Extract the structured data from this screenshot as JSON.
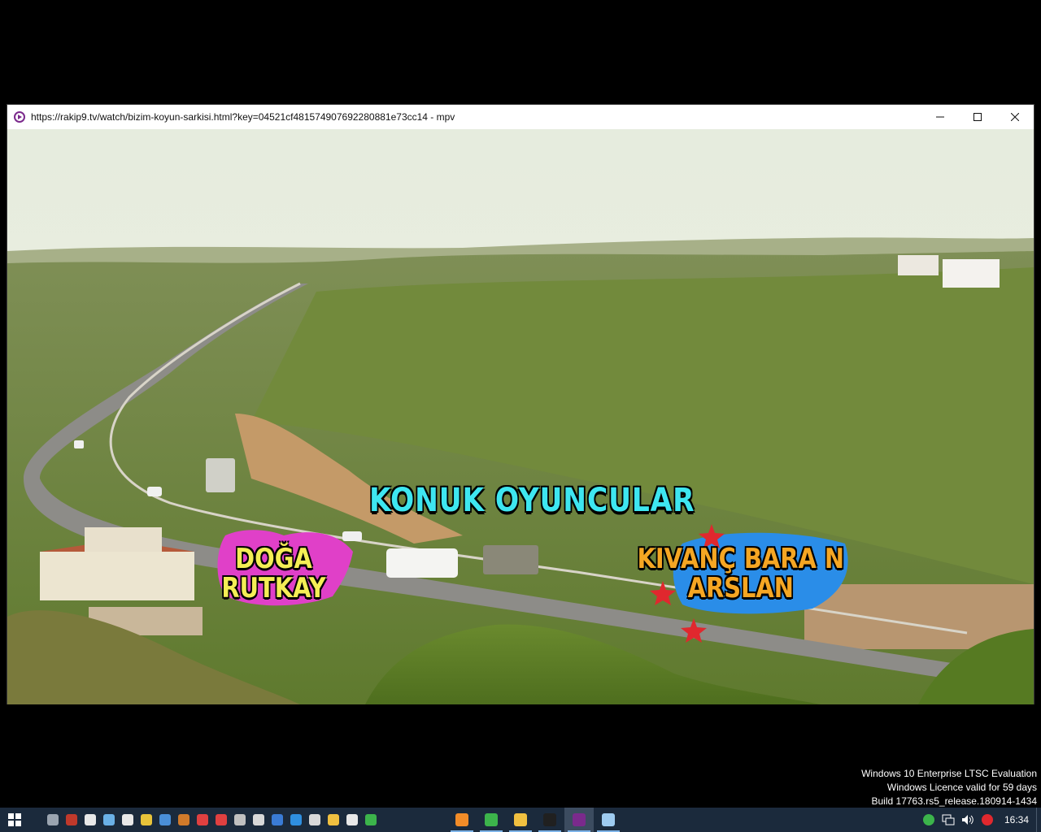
{
  "window": {
    "title": "https://rakip9.tv/watch/bizim-koyun-sarkisi.html?key=04521cf481574907692280881e73cc14 - mpv",
    "app": "mpv",
    "controls": {
      "minimize": "minimize-icon",
      "maximize": "maximize-icon",
      "close": "close-icon"
    }
  },
  "video": {
    "credits_heading": "KONUK OYUNCULAR",
    "credits": [
      {
        "line1": "DOĞA",
        "line2": "RUTKAY"
      },
      {
        "line1": "KIVANÇ BARA N",
        "line2": "ARSLAN"
      }
    ],
    "colors": {
      "heading": "#3ee6f0",
      "name1": "#f4ee55",
      "name2": "#f5a623",
      "splash1": "#e040c8",
      "splash2": "#2a8de8"
    }
  },
  "watermark": {
    "line1": "Windows 10 Enterprise LTSC Evaluation",
    "line2": "Windows Licence valid for 59 days",
    "line3": "Build 17763.rs5_release.180914-1434"
  },
  "taskbar": {
    "start_icon": "windows-icon",
    "quicklaunch": [
      {
        "name": "disk-icon",
        "color": "#9aa4b0"
      },
      {
        "name": "archive-icon",
        "color": "#c0392b"
      },
      {
        "name": "document-icon",
        "color": "#e8e8e8"
      },
      {
        "name": "recycle-icon",
        "color": "#6ab0e6"
      },
      {
        "name": "chess-icon",
        "color": "#e8e8e8"
      },
      {
        "name": "chrome-icon",
        "color": "#e8c33a"
      },
      {
        "name": "rocket-icon",
        "color": "#4a8fd8"
      },
      {
        "name": "gun-icon",
        "color": "#d07a2a"
      },
      {
        "name": "stop-icon",
        "color": "#e04040"
      },
      {
        "name": "compass-icon",
        "color": "#e04040"
      },
      {
        "name": "gear-icon",
        "color": "#c0c0c0"
      },
      {
        "name": "transfer-icon",
        "color": "#d8d8d8"
      },
      {
        "name": "edge-icon",
        "color": "#3a7bd5"
      },
      {
        "name": "vscode-icon",
        "color": "#2f8fe0"
      },
      {
        "name": "monitor-icon",
        "color": "#d8d8d8"
      },
      {
        "name": "folder-icon",
        "color": "#f0c040"
      },
      {
        "name": "notepad-icon",
        "color": "#e8e8e8"
      },
      {
        "name": "exit-icon",
        "color": "#3cb44b"
      }
    ],
    "running": [
      {
        "name": "firefox-icon",
        "color": "#f28c28",
        "active": false
      },
      {
        "name": "utorrent-icon",
        "color": "#3cb44b",
        "active": false
      },
      {
        "name": "explorer-icon",
        "color": "#f0c040",
        "active": false
      },
      {
        "name": "terminal-icon",
        "color": "#202020",
        "active": false
      },
      {
        "name": "mpv-icon",
        "color": "#7b2a8c",
        "active": true
      },
      {
        "name": "notepad-icon",
        "color": "#9ecbf0",
        "active": false
      }
    ],
    "tray": [
      {
        "name": "utorrent-tray-icon"
      },
      {
        "name": "network-icon"
      },
      {
        "name": "volume-icon"
      },
      {
        "name": "shield-icon"
      }
    ],
    "clock": "16:34"
  }
}
